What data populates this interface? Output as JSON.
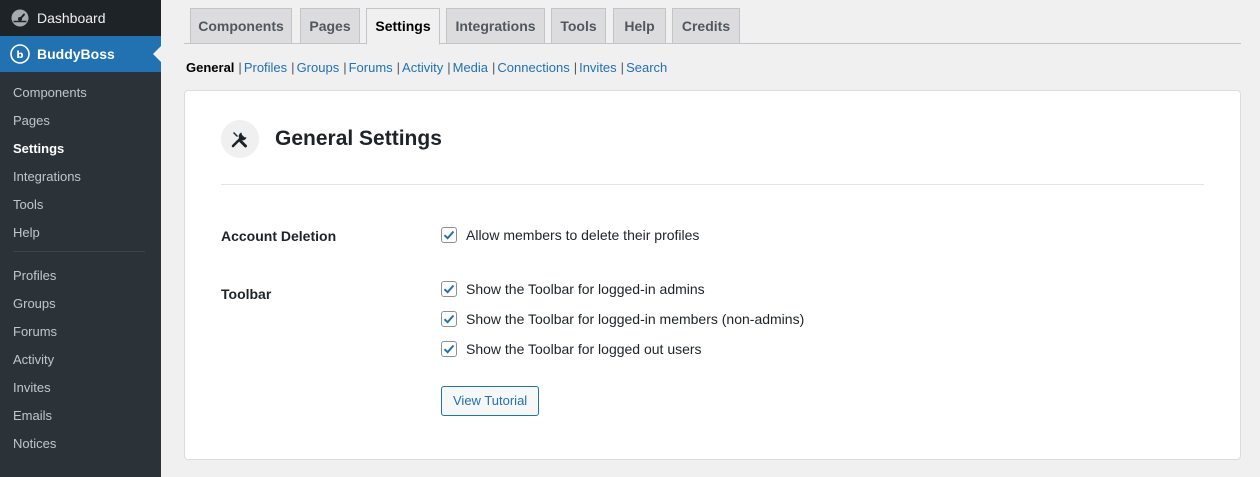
{
  "sidebar": {
    "dashboard_label": "Dashboard",
    "plugin_label": "BuddyBoss",
    "items_group1": [
      "Components",
      "Pages",
      "Settings",
      "Integrations",
      "Tools",
      "Help"
    ],
    "items_group2": [
      "Profiles",
      "Groups",
      "Forums",
      "Activity",
      "Invites",
      "Emails",
      "Notices"
    ],
    "active_item": "Settings"
  },
  "tabs": [
    "Components",
    "Pages",
    "Settings",
    "Integrations",
    "Tools",
    "Help",
    "Credits"
  ],
  "active_tab": "Settings",
  "subnav": [
    "General",
    "Profiles",
    "Groups",
    "Forums",
    "Activity",
    "Media",
    "Connections",
    "Invites",
    "Search"
  ],
  "active_subnav": "General",
  "card": {
    "title": "General Settings",
    "account_deletion": {
      "label": "Account Deletion",
      "option": "Allow members to delete their profiles",
      "checked": true
    },
    "toolbar": {
      "label": "Toolbar",
      "options": [
        "Show the Toolbar for logged-in admins",
        "Show the Toolbar for logged-in members (non-admins)",
        "Show the Toolbar for logged out users"
      ],
      "checked": [
        true,
        true,
        true
      ]
    },
    "tutorial_button": "View Tutorial"
  },
  "colors": {
    "sidebar_bg": "#1d2327",
    "submenu_bg": "#2c3338",
    "accent": "#2271b1",
    "page_bg": "#f0f0f1"
  },
  "icons": {
    "dashboard": "gauge-icon",
    "plugin": "buddyboss-logo-icon",
    "settings_header": "tools-icon",
    "checkbox": "checkmark-icon"
  }
}
